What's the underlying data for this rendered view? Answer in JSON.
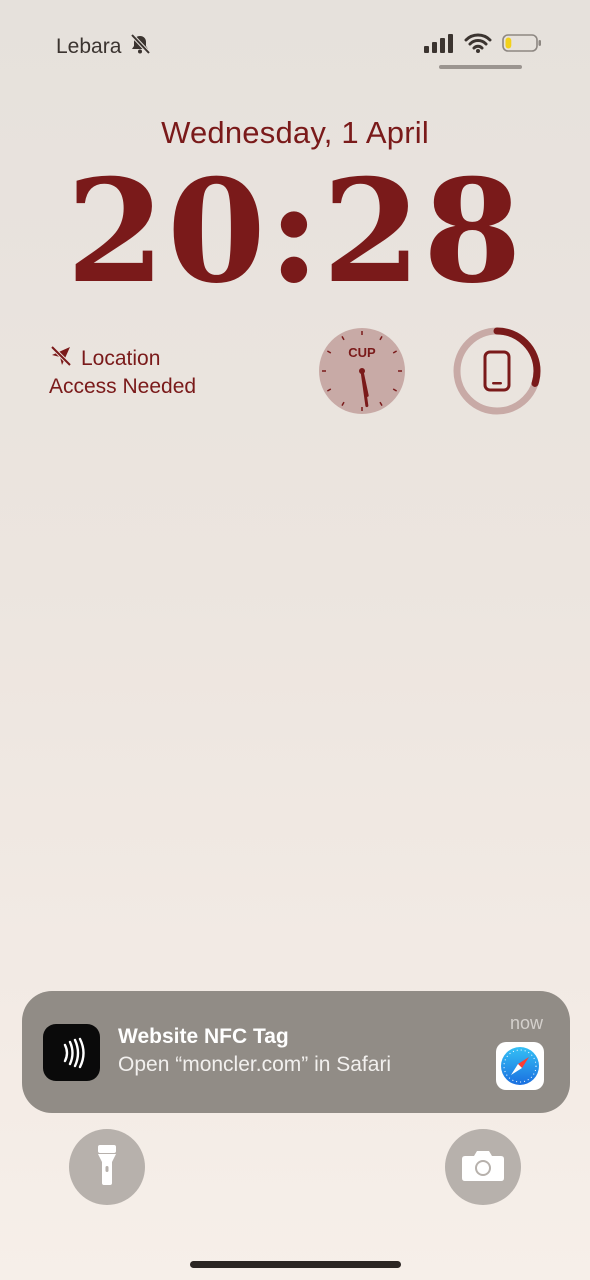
{
  "status_bar": {
    "carrier": "Lebara",
    "icons": [
      "bell-slash-icon",
      "cellular-signal-icon",
      "wifi-icon",
      "battery-low-icon"
    ],
    "battery_level": 0.2,
    "battery_color": "#f2d11a"
  },
  "lock_screen": {
    "date": "Wednesday, 1 April",
    "time": "20:28",
    "accent_color": "#7a1a1a"
  },
  "widgets": {
    "location": {
      "icon": "location-slash-icon",
      "line1": "Location",
      "line2": "Access Needed"
    },
    "world_clock": {
      "city_code": "CUP",
      "hour_hand_deg": 168,
      "minute_hand_deg": 172
    },
    "battery": {
      "icon": "iphone-icon",
      "level": 0.3
    }
  },
  "notification": {
    "app_icon": "nfc-waves-icon",
    "title": "Website NFC Tag",
    "body": "Open “moncler.com” in Safari",
    "time": "now",
    "thumbnail_icon": "safari-compass-icon"
  },
  "quick_actions": {
    "left": "flashlight-icon",
    "right": "camera-icon"
  }
}
